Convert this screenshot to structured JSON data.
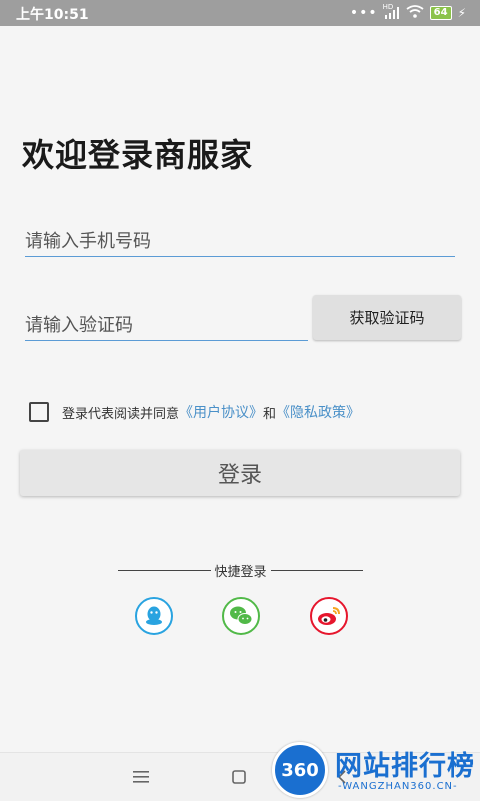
{
  "status_bar": {
    "time": "上午10:51",
    "network_label": "HD",
    "battery_level": "64"
  },
  "page": {
    "title": "欢迎登录商服家"
  },
  "form": {
    "phone_placeholder": "请输入手机号码",
    "code_placeholder": "请输入验证码",
    "get_code_label": "获取验证码"
  },
  "agreement": {
    "prefix": "登录代表阅读并同意",
    "user_agreement": "《用户协议》",
    "conjunction": "和",
    "privacy_policy": "《隐私政策》",
    "checked": false
  },
  "login": {
    "button_label": "登录"
  },
  "quick_login": {
    "label": "快捷登录",
    "providers": [
      {
        "icon": "qq-icon",
        "color": "#29a3e0"
      },
      {
        "icon": "wechat-icon",
        "color": "#51b948"
      },
      {
        "icon": "weibo-icon",
        "color": "#e6162d"
      }
    ]
  },
  "watermark": {
    "badge": "360",
    "title": "网站排行榜",
    "subtitle": "-WANGZHAN360.CN-"
  },
  "colors": {
    "accent_blue": "#5b9bd5",
    "link_blue": "#4a90c8",
    "status_bar_bg": "#9e9e9e",
    "button_bg": "#e6e6e6"
  }
}
